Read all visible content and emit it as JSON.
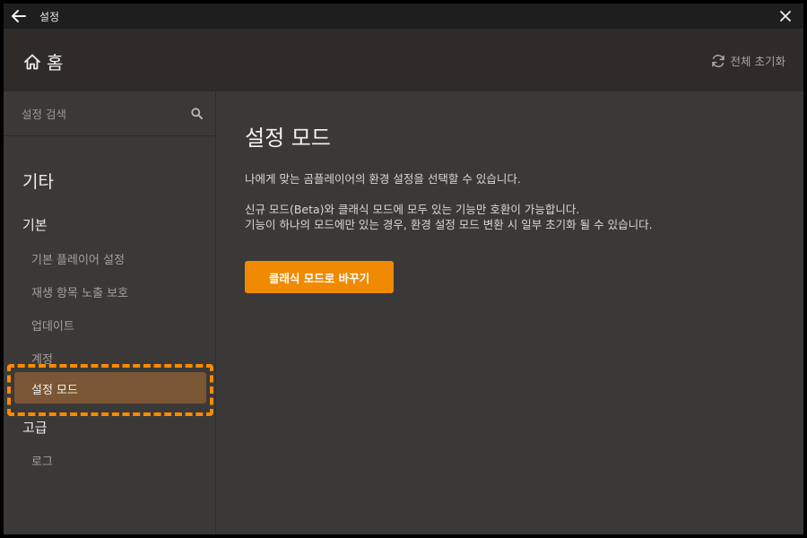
{
  "window": {
    "title": "설정"
  },
  "header": {
    "home_label": "홈",
    "reset_all_label": "전체 초기화"
  },
  "sidebar": {
    "search_placeholder": "설정 검색",
    "section_title": "기타",
    "groups": [
      {
        "title": "기본",
        "items": [
          {
            "label": "기본 플레이어 설정"
          },
          {
            "label": "재생 항목 노출 보호"
          },
          {
            "label": "업데이트"
          },
          {
            "label": "계정"
          },
          {
            "label": "설정 모드",
            "selected": true
          }
        ]
      },
      {
        "title": "고급",
        "items": [
          {
            "label": "로그"
          }
        ]
      }
    ]
  },
  "main": {
    "title": "설정 모드",
    "desc1": "나에게 맞는 곰플레이어의 환경 설정을 선택할 수 있습니다.",
    "desc2_line1": "신규 모드(Beta)와 클래식 모드에 모두 있는 기능만 호환이 가능합니다.",
    "desc2_line2": "기능이 하나의 모드에만 있는 경우, 환경 설정 모드 변환 시 일부 초기화 될 수 있습니다.",
    "switch_button": "클래식 모드로 바꾸기"
  },
  "colors": {
    "accent": "#f08a00",
    "selected_bg": "#7a5634",
    "highlight": "#ff8a00",
    "background": "#3b3938"
  },
  "icons": {
    "back": "arrow-left-icon",
    "close": "close-icon",
    "home": "home-icon",
    "reset": "refresh-icon",
    "search": "search-icon"
  }
}
